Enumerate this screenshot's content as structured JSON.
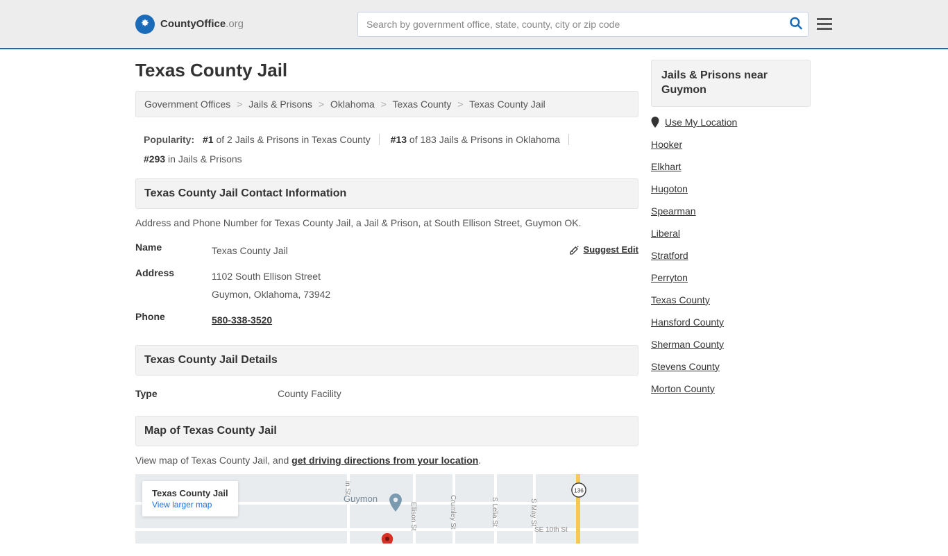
{
  "header": {
    "logo_bold": "CountyOffice",
    "logo_light": ".org",
    "search_placeholder": "Search by government office, state, county, city or zip code"
  },
  "page_title": "Texas County Jail",
  "breadcrumb": {
    "items": [
      "Government Offices",
      "Jails & Prisons",
      "Oklahoma",
      "Texas County",
      "Texas County Jail"
    ]
  },
  "popularity": {
    "label": "Popularity:",
    "items": [
      {
        "rank": "#1",
        "rest": " of 2 Jails & Prisons in Texas County"
      },
      {
        "rank": "#13",
        "rest": " of 183 Jails & Prisons in Oklahoma"
      },
      {
        "rank": "#293",
        "rest": " in Jails & Prisons"
      }
    ]
  },
  "contact": {
    "header": "Texas County Jail Contact Information",
    "desc": "Address and Phone Number for Texas County Jail, a Jail & Prison, at South Ellison Street, Guymon OK.",
    "suggest_edit": "Suggest Edit",
    "name_label": "Name",
    "name_value": "Texas County Jail",
    "address_label": "Address",
    "address_line1": "1102 South Ellison Street",
    "address_line2": "Guymon, Oklahoma, 73942",
    "phone_label": "Phone",
    "phone_value": "580-338-3520"
  },
  "details": {
    "header": "Texas County Jail Details",
    "type_label": "Type",
    "type_value": "County Facility"
  },
  "map": {
    "header": "Map of Texas County Jail",
    "desc_prefix": "View map of Texas County Jail, and ",
    "desc_link": "get driving directions from your location",
    "overlay_title": "Texas County Jail",
    "overlay_link": "View larger map",
    "town_label": "Guymon",
    "highway": "136",
    "street1": "SE 10th St",
    "street2": "Ellison St",
    "street3": "Crumley St",
    "street4": "S Lelia St",
    "street5": "S May St",
    "street6": "in St"
  },
  "sidebar": {
    "header": "Jails & Prisons near Guymon",
    "use_location": "Use My Location",
    "links": [
      "Hooker",
      "Elkhart",
      "Hugoton",
      "Spearman",
      "Liberal",
      "Stratford",
      "Perryton",
      "Texas County",
      "Hansford County",
      "Sherman County",
      "Stevens County",
      "Morton County"
    ]
  }
}
